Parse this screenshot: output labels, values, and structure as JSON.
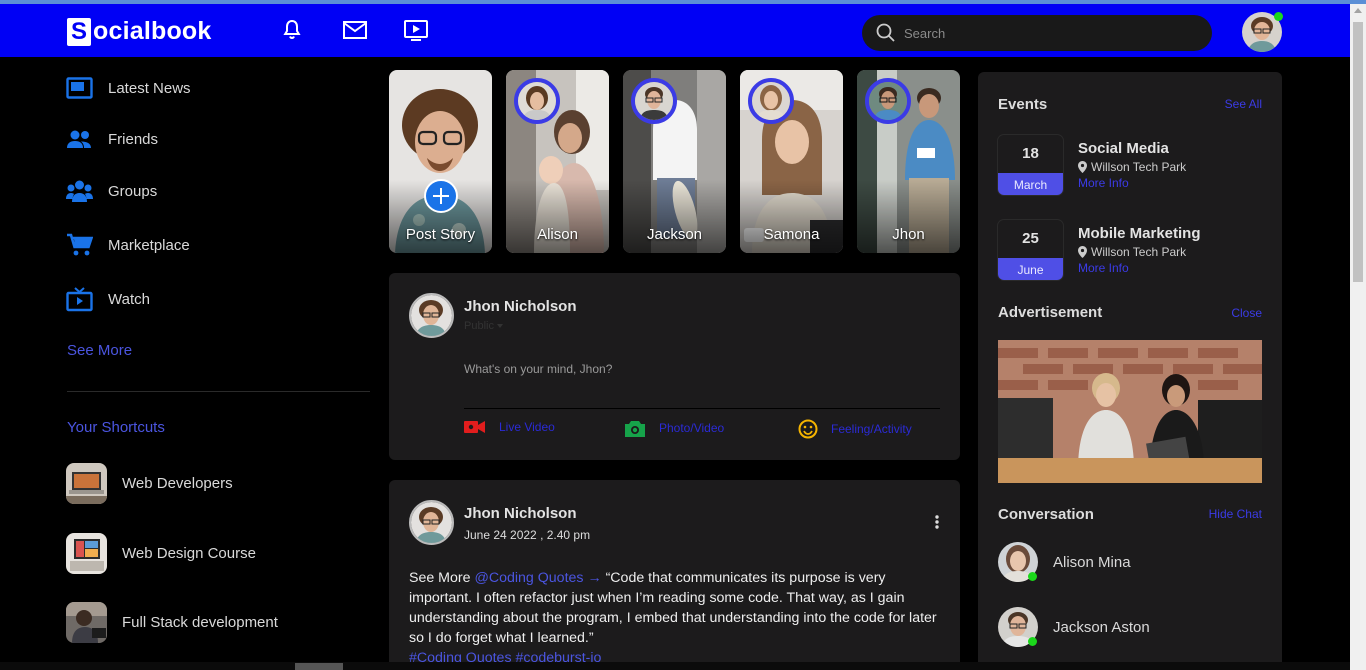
{
  "app": {
    "logo_letter": "S",
    "logo_text": "ocialbook"
  },
  "header": {
    "icons": [
      "bell-icon",
      "mail-icon",
      "video-icon"
    ],
    "search_placeholder": "Search"
  },
  "sidebar": {
    "items": [
      {
        "label": "Latest News",
        "icon": "news-icon"
      },
      {
        "label": "Friends",
        "icon": "friends-icon"
      },
      {
        "label": "Groups",
        "icon": "groups-icon"
      },
      {
        "label": "Marketplace",
        "icon": "cart-icon"
      },
      {
        "label": "Watch",
        "icon": "tv-icon"
      }
    ],
    "see_more": "See More",
    "shortcuts_title": "Your Shortcuts",
    "shortcuts": [
      {
        "label": "Web Developers"
      },
      {
        "label": "Web Design Course"
      },
      {
        "label": "Full Stack development"
      }
    ]
  },
  "stories": [
    {
      "name": "Post Story"
    },
    {
      "name": "Alison"
    },
    {
      "name": "Jackson"
    },
    {
      "name": "Samona"
    },
    {
      "name": "Jhon"
    }
  ],
  "composer": {
    "user_name": "Jhon Nicholson",
    "privacy": "Public",
    "placeholder": "What's on your mind, Jhon?",
    "actions": [
      {
        "label": "Live Video",
        "icon": "video-camera-icon",
        "color": "#e11d1d"
      },
      {
        "label": "Photo/Video",
        "icon": "camera-icon",
        "color": "#16a34a"
      },
      {
        "label": "Feeling/Activity",
        "icon": "smile-icon",
        "color": "#f5b400"
      }
    ]
  },
  "post": {
    "user_name": "Jhon Nicholson",
    "date": "June 24 2022 , 2.40 pm",
    "text_prefix": "See More ",
    "mention": "@Coding Quotes",
    "arrow": "→",
    "text": " “Code that communicates its purpose is very important. I often refactor just when I’m reading some code. That way, as I gain understanding about the program, I embed that understanding into the code for later so I do forget what I learned.”",
    "tags": "#Coding Quotes #codeburst-io"
  },
  "events": {
    "title": "Events",
    "see_all": "See All",
    "items": [
      {
        "day": "18",
        "month": "March",
        "title": "Social Media",
        "location": "Willson Tech Park",
        "more": "More Info"
      },
      {
        "day": "25",
        "month": "June",
        "title": "Mobile Marketing",
        "location": "Willson Tech Park",
        "more": "More Info"
      }
    ]
  },
  "advertisement": {
    "title": "Advertisement",
    "close": "Close"
  },
  "conversation": {
    "title": "Conversation",
    "hide": "Hide Chat",
    "contacts": [
      {
        "name": "Alison Mina",
        "online": true
      },
      {
        "name": "Jackson Aston",
        "online": true
      }
    ]
  },
  "colors": {
    "nav": "#0000f5",
    "accent": "#4b55e0",
    "online": "#1bd81b"
  }
}
